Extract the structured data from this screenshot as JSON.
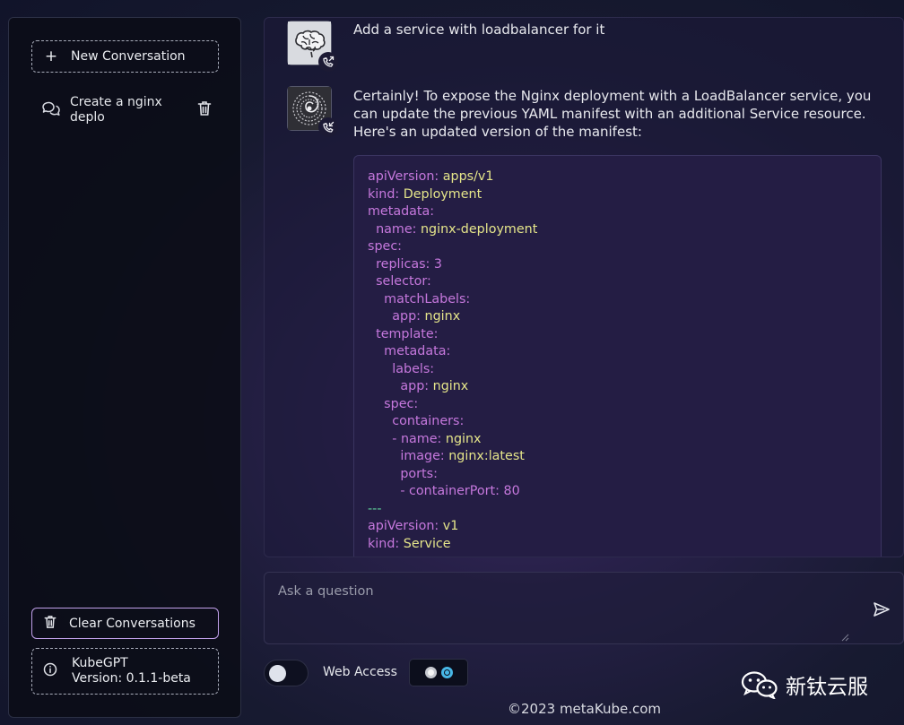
{
  "sidebar": {
    "new_conversation": "New Conversation",
    "conversations": [
      {
        "title": "Create a nginx deplo"
      }
    ],
    "clear_conversations": "Clear Conversations",
    "app_name": "KubeGPT",
    "version": "Version: 0.1.1-beta"
  },
  "chat": {
    "user_message": "Add a service with loadbalancer for it",
    "bot_message": "Certainly! To expose the Nginx deployment with a LoadBalancer service, you can update the previous YAML manifest with an additional Service resource. Here's an updated version of the manifest:",
    "code_lines": [
      [
        "apiVersion: ",
        "apps/v1"
      ],
      [
        "kind: ",
        "Deployment"
      ],
      [
        "metadata:",
        ""
      ],
      [
        "  name: ",
        "nginx-deployment"
      ],
      [
        "spec:",
        ""
      ],
      [
        "  replicas: 3",
        ""
      ],
      [
        "  selector:",
        ""
      ],
      [
        "    matchLabels:",
        ""
      ],
      [
        "      app: ",
        "nginx"
      ],
      [
        "  template:",
        ""
      ],
      [
        "    metadata:",
        ""
      ],
      [
        "      labels:",
        ""
      ],
      [
        "        app: ",
        "nginx"
      ],
      [
        "    spec:",
        ""
      ],
      [
        "      containers:",
        ""
      ],
      [
        "      - name: ",
        "nginx"
      ],
      [
        "        image: ",
        "nginx:latest"
      ],
      [
        "        ports:",
        ""
      ],
      [
        "        - containerPort: 80",
        ""
      ],
      [
        "---",
        ""
      ],
      [
        "apiVersion: ",
        "v1"
      ],
      [
        "kind: ",
        "Service"
      ]
    ]
  },
  "input": {
    "placeholder": "Ask a question",
    "value": ""
  },
  "web_access": {
    "label": "Web Access",
    "enabled": false
  },
  "footer": "©2023 metaKube.com",
  "watermark": "新钛云服",
  "icons": {
    "new": "plus-icon",
    "chat": "chat-bubbles-icon",
    "trash": "trash-icon",
    "info": "info-icon",
    "send": "send-icon",
    "call": "phone-icon"
  }
}
